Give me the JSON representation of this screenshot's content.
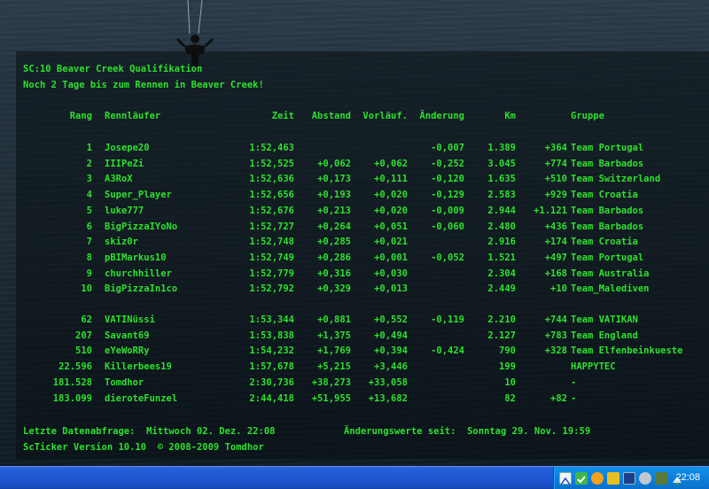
{
  "header": {
    "title": "SC:10 Beaver Creek Qualifikation",
    "subtitle": "Noch 2 Tage bis zum Rennen in Beaver Creek!"
  },
  "columns": {
    "rang": "Rang",
    "name": "Rennläufer",
    "zeit": "Zeit",
    "abstand": "Abstand",
    "vorlauf": "Vorläuf.",
    "aenderung": "Änderung",
    "km": "Km",
    "gruppe": "Gruppe"
  },
  "rows_top": [
    {
      "rang": "1",
      "name": "Josepe20",
      "zeit": "1:52,463",
      "abstand": "",
      "vorlauf": "",
      "aenderung": "-0,007",
      "km": "1.389",
      "kmdiff": "+364",
      "gruppe": "Team Portugal"
    },
    {
      "rang": "2",
      "name": "IIIPeZi",
      "zeit": "1:52,525",
      "abstand": "+0,062",
      "vorlauf": "+0,062",
      "aenderung": "-0,252",
      "km": "3.045",
      "kmdiff": "+774",
      "gruppe": "Team Barbados"
    },
    {
      "rang": "3",
      "name": "A3RoX",
      "zeit": "1:52,636",
      "abstand": "+0,173",
      "vorlauf": "+0,111",
      "aenderung": "-0,120",
      "km": "1.635",
      "kmdiff": "+510",
      "gruppe": "Team Switzerland"
    },
    {
      "rang": "4",
      "name": "Super_Player",
      "zeit": "1:52,656",
      "abstand": "+0,193",
      "vorlauf": "+0,020",
      "aenderung": "-0,129",
      "km": "2.583",
      "kmdiff": "+929",
      "gruppe": "Team Croatia"
    },
    {
      "rang": "5",
      "name": "luke777",
      "zeit": "1:52,676",
      "abstand": "+0,213",
      "vorlauf": "+0,020",
      "aenderung": "-0,009",
      "km": "2.944",
      "kmdiff": "+1.121",
      "gruppe": "Team Barbados"
    },
    {
      "rang": "6",
      "name": "BigPizzaIYoNo",
      "zeit": "1:52,727",
      "abstand": "+0,264",
      "vorlauf": "+0,051",
      "aenderung": "-0,060",
      "km": "2.480",
      "kmdiff": "+436",
      "gruppe": "Team Barbados"
    },
    {
      "rang": "7",
      "name": "skiz0r",
      "zeit": "1:52,748",
      "abstand": "+0,285",
      "vorlauf": "+0,021",
      "aenderung": "",
      "km": "2.916",
      "kmdiff": "+174",
      "gruppe": "Team Croatia"
    },
    {
      "rang": "8",
      "name": "pBIMarkus10",
      "zeit": "1:52,749",
      "abstand": "+0,286",
      "vorlauf": "+0,001",
      "aenderung": "-0,052",
      "km": "1.521",
      "kmdiff": "+497",
      "gruppe": "Team Portugal"
    },
    {
      "rang": "9",
      "name": "churchhiller",
      "zeit": "1:52,779",
      "abstand": "+0,316",
      "vorlauf": "+0,030",
      "aenderung": "",
      "km": "2.304",
      "kmdiff": "+168",
      "gruppe": "Team Australia"
    },
    {
      "rang": "10",
      "name": "BigPizzaIn1co",
      "zeit": "1:52,792",
      "abstand": "+0,329",
      "vorlauf": "+0,013",
      "aenderung": "",
      "km": "2.449",
      "kmdiff": "+10",
      "gruppe": "Team_Malediven"
    }
  ],
  "rows_bottom": [
    {
      "rang": "62",
      "name": "VATINüssi",
      "zeit": "1:53,344",
      "abstand": "+0,881",
      "vorlauf": "+0,552",
      "aenderung": "-0,119",
      "km": "2.210",
      "kmdiff": "+744",
      "gruppe": "Team VATIKAN"
    },
    {
      "rang": "207",
      "name": "Savant69",
      "zeit": "1:53,838",
      "abstand": "+1,375",
      "vorlauf": "+0,494",
      "aenderung": "",
      "km": "2.127",
      "kmdiff": "+783",
      "gruppe": "Team England"
    },
    {
      "rang": "510",
      "name": "eYeWoRRy",
      "zeit": "1:54,232",
      "abstand": "+1,769",
      "vorlauf": "+0,394",
      "aenderung": "-0,424",
      "km": "790",
      "kmdiff": "+328",
      "gruppe": "Team Elfenbeinkueste"
    },
    {
      "rang": "22.596",
      "name": "Killerbees19",
      "zeit": "1:57,678",
      "abstand": "+5,215",
      "vorlauf": "+3,446",
      "aenderung": "",
      "km": "199",
      "kmdiff": "",
      "gruppe": "HAPPYTEC"
    },
    {
      "rang": "181.528",
      "name": "Tomdhor",
      "zeit": "2:30,736",
      "abstand": "+38,273",
      "vorlauf": "+33,058",
      "aenderung": "",
      "km": "10",
      "kmdiff": "",
      "gruppe": "-"
    },
    {
      "rang": "183.099",
      "name": "dieroteFunzel",
      "zeit": "2:44,418",
      "abstand": "+51,955",
      "vorlauf": "+13,682",
      "aenderung": "",
      "km": "82",
      "kmdiff": "+82",
      "gruppe": "-"
    }
  ],
  "footer": {
    "last_query": "Letzte Datenabfrage:  Mittwoch 02. Dez. 22:08",
    "changes_since": "Änderungswerte seit:  Sonntag 29. Nov. 19:59",
    "version": "ScTicker Version 10.10  © 2008-2009 Tomdhor"
  },
  "taskbar": {
    "clock": "22:08"
  },
  "colors": {
    "ticker_text": "#2ee02e",
    "taskbar": "#245edb",
    "tray": "#0c7fdc"
  }
}
